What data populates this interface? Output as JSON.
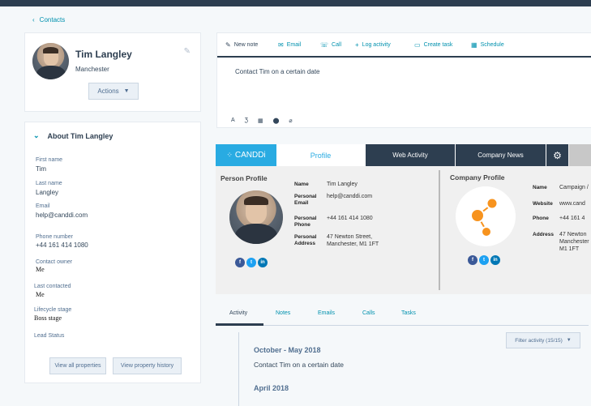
{
  "breadcrumb": {
    "back_icon": "chevron-left-icon",
    "label": "Contacts"
  },
  "contact": {
    "name": "Tim Langley",
    "city": "Manchester",
    "actions_label": "Actions",
    "edit_icon": "pencil-icon"
  },
  "about": {
    "title": "About Tim Langley",
    "properties": [
      {
        "label": "First name",
        "value": "Tim"
      },
      {
        "label": "Last name",
        "value": "Langley"
      },
      {
        "label": "Email",
        "value": "help@canddi.com"
      },
      {
        "label": "Phone number",
        "value": "+44 161 414 1080"
      },
      {
        "label": "Contact owner",
        "value": "Me"
      },
      {
        "label": "Last contacted",
        "value": "Me"
      },
      {
        "label": "Lifecycle stage",
        "value": "Boss stage"
      },
      {
        "label": "Lead Status",
        "value": ""
      }
    ],
    "view_all_label": "View all properties",
    "history_label": "View property history"
  },
  "compose": {
    "tabs": [
      {
        "label": "New note",
        "icon": "edit-icon"
      },
      {
        "label": "Email",
        "icon": "envelope-icon"
      },
      {
        "label": "Call",
        "icon": "phone-icon"
      },
      {
        "label": "Log activity",
        "icon": "plus-icon"
      },
      {
        "label": "Create task",
        "icon": "task-icon"
      },
      {
        "label": "Schedule",
        "icon": "calendar-icon"
      }
    ],
    "note_text": "Contact Tim on a certain date",
    "format_tools": [
      "A",
      "Ʒ",
      "▦",
      "⬤",
      "⌀"
    ]
  },
  "canddi": {
    "logo_text": "CANDDi",
    "tabs": [
      "Profile",
      "Web Activity",
      "Company News"
    ],
    "person_heading": "Person Profile",
    "person_fields": [
      {
        "label": "Name",
        "value": "Tim Langley"
      },
      {
        "label": "Personal Email",
        "value": "help@canddi.com"
      },
      {
        "label": "Personal Phone",
        "value": "+44 161 414 1080"
      },
      {
        "label": "Personal Address",
        "value": "47 Newton Street, Manchester, M1 1FT"
      }
    ],
    "company_heading": "Company Profile",
    "company_fields": [
      {
        "label": "Name",
        "value": "Campaign /"
      },
      {
        "label": "Website",
        "value": "www.cand"
      },
      {
        "label": "Phone",
        "value": "+44 161 4"
      },
      {
        "label": "Address",
        "value": "47 Newton Manchester M1 1FT"
      }
    ],
    "social": [
      "f",
      "t",
      "in"
    ]
  },
  "activity": {
    "tabs": [
      "Activity",
      "Notes",
      "Emails",
      "Calls",
      "Tasks"
    ],
    "filter_label": "Filter activity (15/15)",
    "month1": "October - May 2018",
    "item1": "Contact Tim on a certain date",
    "month2": "April 2018"
  },
  "colors": {
    "accent": "#0091ae",
    "dark": "#2d3e50",
    "canddi_blue": "#29abe2",
    "orange": "#f7931e"
  }
}
